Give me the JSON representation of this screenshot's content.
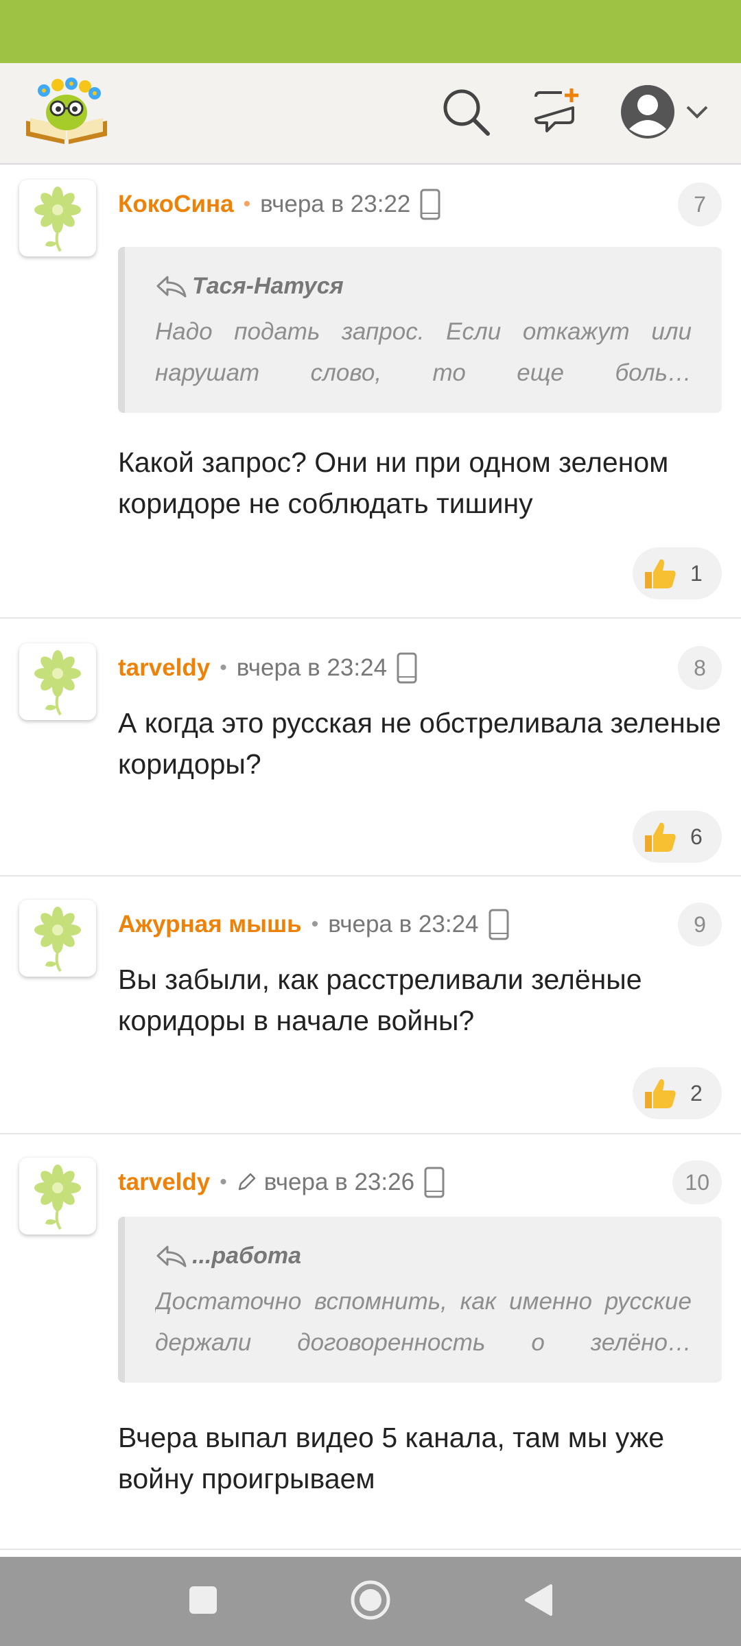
{
  "header": {
    "logo_icon": "book-flowers-mascot-icon",
    "search_icon": "search-icon",
    "new_post_icon": "new-post-icon",
    "profile_icon": "user-avatar-icon",
    "dropdown_icon": "chevron-down-icon"
  },
  "comments": [
    {
      "author": "КокоСина",
      "time": "вчера в 23:22",
      "number": "7",
      "quote_author": "Тася-Натуся",
      "quote_text": "Надо подать запрос. Если откажут или нарушат слово, то еще боль…",
      "text": "Какой запрос? Они ни при одном зеленом коридоре не соблюдать тишину",
      "likes": "1"
    },
    {
      "author": "tarveldy",
      "time": "вчера в 23:24",
      "number": "8",
      "text": "А когда это русская не обстреливала зеленые коридоры?",
      "likes": "6"
    },
    {
      "author": "Ажурная мышь",
      "time": "вчера в 23:24",
      "number": "9",
      "text": "Вы забыли, как расстреливали зелёные коридоры в начале войны?",
      "likes": "2"
    },
    {
      "author": "tarveldy",
      "time": "вчера в 23:26",
      "number": "10",
      "quote_author": "...работа",
      "quote_text": "Достаточно вспомнить, как именно русские держали договоренность о зелёно…",
      "text": "Вчера выпал видео 5 канала, там мы уже войну проигрываем"
    }
  ],
  "colors": {
    "status_bar": "#9dc244",
    "author": "#ee8208",
    "nav_bar": "#9a9a9a"
  }
}
